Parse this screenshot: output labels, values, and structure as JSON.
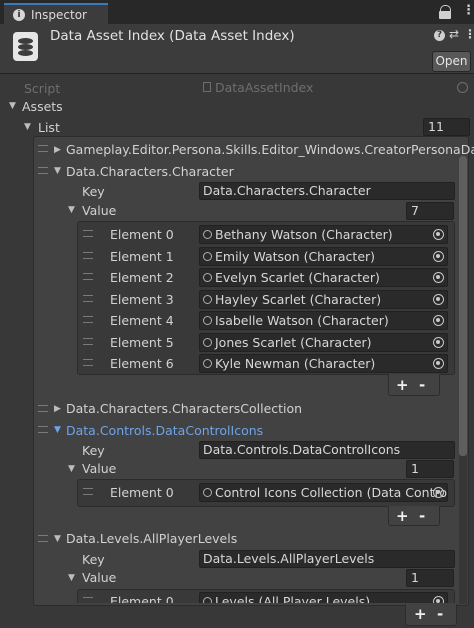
{
  "tab": {
    "icon": "info-icon",
    "label": "Inspector"
  },
  "header": {
    "icon": "database-icon",
    "title": "Data Asset Index (Data Asset Index)",
    "open_label": "Open"
  },
  "script_row": {
    "label": "Script",
    "value": "DataAssetIndex"
  },
  "assets": {
    "label": "Assets",
    "list_label": "List",
    "list_count": "11",
    "items": [
      {
        "label": "Gameplay.Editor.Persona.Skills.Editor_Windows.CreatorPersonaData"
      },
      {
        "label": "Data.Characters.Character",
        "key_label": "Key",
        "key_value": "Data.Characters.Character",
        "value_label": "Value",
        "value_count": "7",
        "elements": [
          {
            "label": "Element 0",
            "value": "Bethany Watson (Character)"
          },
          {
            "label": "Element 1",
            "value": "Emily Watson (Character)"
          },
          {
            "label": "Element 2",
            "value": "Evelyn Scarlet (Character)"
          },
          {
            "label": "Element 3",
            "value": "Hayley Scarlet (Character)"
          },
          {
            "label": "Element 4",
            "value": "Isabelle Watson (Character)"
          },
          {
            "label": "Element 5",
            "value": "Jones Scarlet (Character)"
          },
          {
            "label": "Element 6",
            "value": "Kyle Newman (Character)"
          }
        ]
      },
      {
        "label": "Data.Characters.CharactersCollection"
      },
      {
        "label": "Data.Controls.DataControlIcons",
        "key_label": "Key",
        "key_value": "Data.Controls.DataControlIcons",
        "value_label": "Value",
        "value_count": "1",
        "elements": [
          {
            "label": "Element 0",
            "value": "Control Icons Collection (Data Control I"
          }
        ]
      },
      {
        "label": "Data.Levels.AllPlayerLevels",
        "key_label": "Key",
        "key_value": "Data.Levels.AllPlayerLevels",
        "value_label": "Value",
        "value_count": "1",
        "elements": [
          {
            "label": "Element 0",
            "value": "Levels (All Player Levels)"
          }
        ]
      }
    ]
  },
  "plus": "+",
  "minus": "-"
}
